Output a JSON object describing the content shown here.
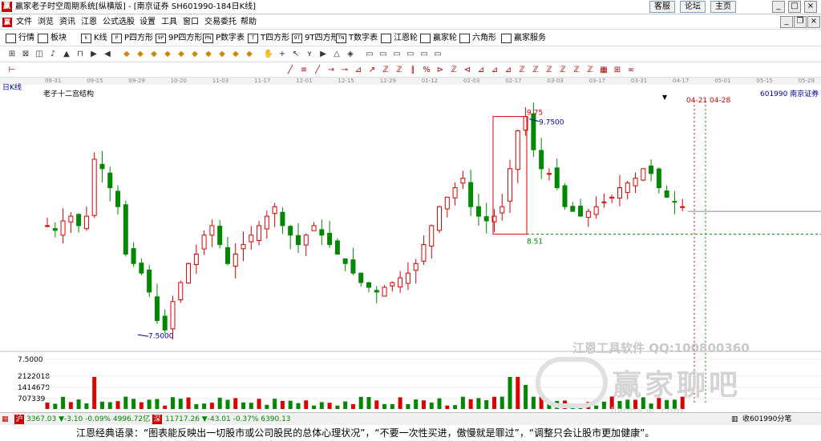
{
  "window": {
    "title": "赢家老子时空周期系统[纵横版] - [南京证券  SH601990-184日K线]",
    "buttons": [
      "客服",
      "论坛",
      "主页"
    ]
  },
  "menu": [
    "文件",
    "浏览",
    "资讯",
    "江恩",
    "公式选股",
    "设置",
    "工具",
    "窗口",
    "交易委托",
    "帮助"
  ],
  "toolbar1": [
    {
      "icon": "grid",
      "label": "行情"
    },
    {
      "icon": "blocks",
      "label": "板块"
    },
    {
      "icon": "k",
      "label": "K线"
    },
    {
      "icon": "P",
      "label": "P四方形"
    },
    {
      "icon": "9P",
      "label": "9P四方形"
    },
    {
      "icon": "PN",
      "label": "P数字表"
    },
    {
      "icon": "T",
      "label": "T四方形"
    },
    {
      "icon": "9T",
      "label": "9T四方形"
    },
    {
      "icon": "TN",
      "label": "T数字表"
    },
    {
      "icon": "wheel",
      "label": "江恩轮"
    },
    {
      "icon": "wheel",
      "label": "赢家轮"
    },
    {
      "icon": "hex",
      "label": "六角形"
    },
    {
      "icon": "money",
      "label": "赢家服务"
    }
  ],
  "date_ticks": [
    "08-31",
    "09-15",
    "09-29",
    "10-20",
    "11-03",
    "11-17",
    "12-01",
    "12-15",
    "12-29",
    "01-12",
    "02-03",
    "02-17",
    "03-03",
    "03-17",
    "03-31",
    "04-17",
    "05-01",
    "05-15",
    "05-29"
  ],
  "chart_labels": {
    "period": "日K线",
    "structure": "老子十二宫结构",
    "stock": "601990 南京证券",
    "high1": "9.75",
    "high2": "9.7500",
    "low_box": "8.51",
    "low": "7.5000",
    "dates": "04-21 04-28",
    "vol_scale": [
      "7.5000",
      "2122018",
      "1414679",
      "707339"
    ]
  },
  "chart_data": {
    "type": "candlestick",
    "title": "",
    "xlabel": "",
    "ylabel": "",
    "ylim": [
      7.3,
      10.0
    ],
    "annotations": {
      "box_high": 9.75,
      "box_low": 8.51,
      "low_mark": 7.5,
      "high_mark": 9.75
    }
  },
  "status": {
    "sh": "3367.03 ▼-3.10 -0.09% 4996.72亿",
    "sz": "11717.26 ▼-43.01 -0.37% 6390.13",
    "right": "收601990分笔"
  },
  "watermark": {
    "line1": "江恩工具软件  QQ:100800360",
    "line2": "赢家聊吧",
    "line3": "liaoba.w  .com"
  },
  "quote": "江恩经典语录：“图表能反映出一切股市或公司股民的总体心理状况”，“不要一次性买进，傲慢就是罪过”，“调整只会让股市更加健康”。"
}
